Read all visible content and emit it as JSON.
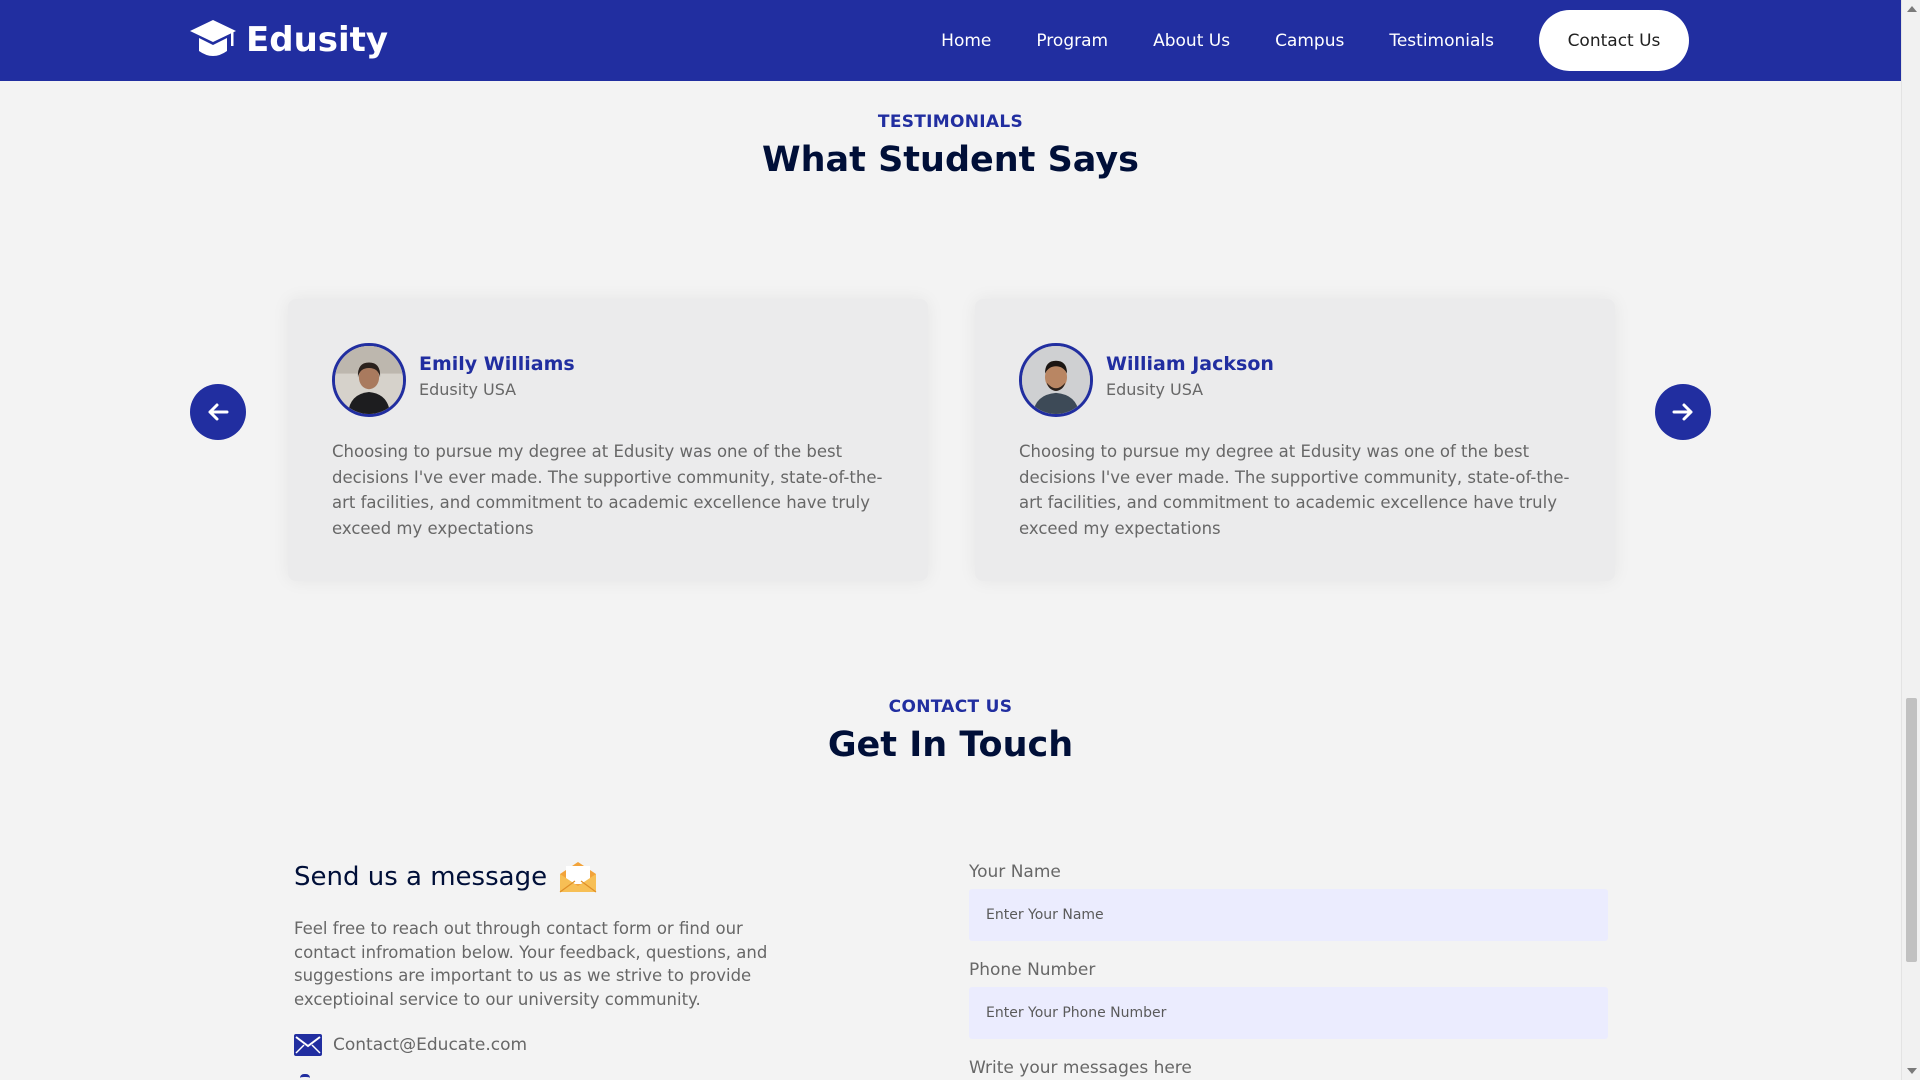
{
  "header": {
    "logo_text": "Edusity",
    "nav": [
      "Home",
      "Program",
      "About Us",
      "Campus",
      "Testimonials"
    ],
    "contact_button": "Contact Us"
  },
  "testimonials": {
    "subtitle": "TESTIMONIALS",
    "title": "What Student Says",
    "cards": [
      {
        "name": "Emily Williams",
        "org": "Edusity USA",
        "text": "Choosing to pursue my degree at Edusity was one of the best decisions I've ever made. The supportive community, state-of-the-art facilities, and commitment to academic excellence have truly exceed my expectations"
      },
      {
        "name": "William Jackson",
        "org": "Edusity USA",
        "text": "Choosing to pursue my degree at Edusity was one of the best decisions I've ever made. The supportive community, state-of-the-art facilities, and commitment to academic excellence have truly exceed my expectations"
      }
    ]
  },
  "contact": {
    "subtitle": "CONTACT US",
    "title": "Get In Touch",
    "message_title": "Send us a message",
    "message_text": "Feel free to reach out through contact form or find our contact infromation below. Your feedback, questions, and suggestions are important to us as we strive to provide exceptioinal service to our university community.",
    "email": "Contact@Educate.com",
    "form": {
      "name_label": "Your Name",
      "name_placeholder": "Enter Your Name",
      "phone_label": "Phone Number",
      "phone_placeholder": "Enter Your Phone Number",
      "message_label": "Write your messages here"
    }
  },
  "colors": {
    "primary": "#212ea0",
    "heading": "#000f38",
    "body_text": "#676767",
    "input_bg": "#ebecfe",
    "page_bg": "#f3f3f3"
  },
  "icons": [
    "graduation-cap-icon",
    "arrow-left-icon",
    "arrow-right-icon",
    "envelope-open-icon",
    "mail-icon"
  ]
}
